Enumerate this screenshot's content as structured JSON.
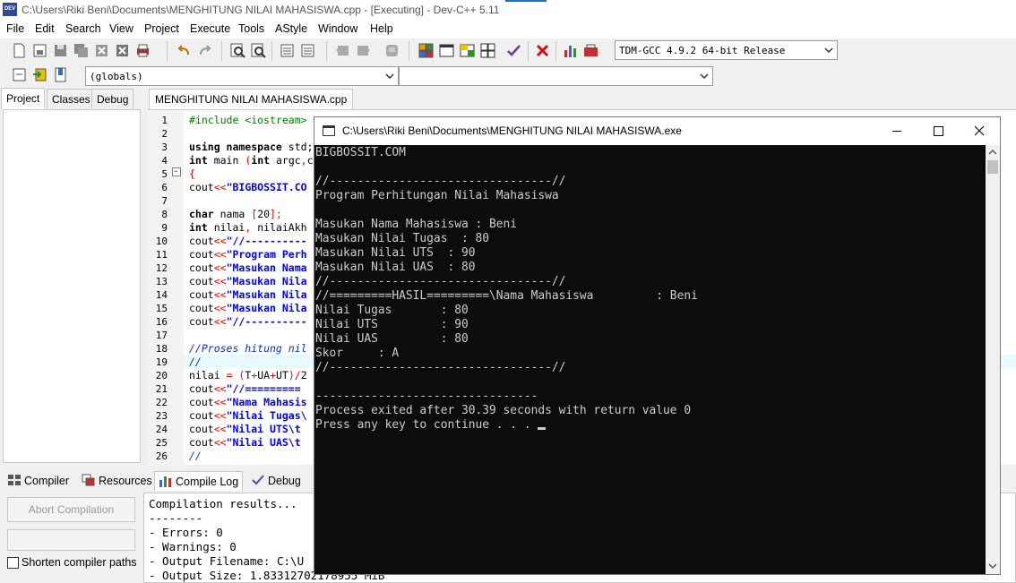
{
  "window": {
    "title": "C:\\Users\\Riki Beni\\Documents\\MENGHITUNG NILAI MAHASISWA.cpp - [Executing] - Dev-C++ 5.11",
    "app_icon_label": "DEV"
  },
  "menu": [
    "File",
    "Edit",
    "Search",
    "View",
    "Project",
    "Execute",
    "Tools",
    "AStyle",
    "Window",
    "Help"
  ],
  "toolbar": {
    "compiler_select": "TDM-GCC 4.9.2 64-bit Release",
    "scope_select": "(globals)",
    "member_select": ""
  },
  "left_panel": {
    "tabs": [
      "Project",
      "Classes",
      "Debug"
    ],
    "active_tab": "Project"
  },
  "editor": {
    "file_tab": "MENGHITUNG NILAI MAHASISWA.cpp",
    "line_numbers": [
      "1",
      "2",
      "3",
      "4",
      "5",
      "6",
      "7",
      "8",
      "9",
      "10",
      "11",
      "12",
      "13",
      "14",
      "15",
      "16",
      "17",
      "18",
      "19",
      "20",
      "21",
      "22",
      "23",
      "24",
      "25",
      "26"
    ],
    "lines": [
      [
        {
          "t": "#include <iostream>",
          "c": "pp"
        }
      ],
      [],
      [
        {
          "t": "using namespace ",
          "c": "kw"
        },
        {
          "t": "std;",
          "c": ""
        }
      ],
      [
        {
          "t": "int ",
          "c": "kw"
        },
        {
          "t": "main ",
          "c": ""
        },
        {
          "t": "(",
          "c": "op"
        },
        {
          "t": "int ",
          "c": "kw"
        },
        {
          "t": "argc",
          "c": ""
        },
        {
          "t": ",",
          "c": "op"
        },
        {
          "t": "c",
          "c": ""
        }
      ],
      [
        {
          "t": "{",
          "c": "op"
        }
      ],
      [
        {
          "t": " cout",
          "c": ""
        },
        {
          "t": "<<",
          "c": "op"
        },
        {
          "t": "\"BIGBOSSIT.CO",
          "c": "str"
        }
      ],
      [],
      [
        {
          "t": "  char ",
          "c": "kw"
        },
        {
          "t": "nama ",
          "c": ""
        },
        {
          "t": "[",
          "c": "op"
        },
        {
          "t": "20",
          "c": ""
        },
        {
          "t": "];",
          "c": "op"
        }
      ],
      [
        {
          "t": "  int ",
          "c": "kw"
        },
        {
          "t": "nilai",
          "c": ""
        },
        {
          "t": ", ",
          "c": "op"
        },
        {
          "t": "nilaiAkh",
          "c": ""
        }
      ],
      [
        {
          "t": "  cout",
          "c": ""
        },
        {
          "t": "<<",
          "c": "op"
        },
        {
          "t": "\"//----------",
          "c": "str"
        }
      ],
      [
        {
          "t": "  cout",
          "c": ""
        },
        {
          "t": "<<",
          "c": "op"
        },
        {
          "t": "\"Program Perh",
          "c": "str"
        }
      ],
      [
        {
          "t": "  cout",
          "c": ""
        },
        {
          "t": "<<",
          "c": "op"
        },
        {
          "t": "\"Masukan Nama",
          "c": "str"
        }
      ],
      [
        {
          "t": "  cout",
          "c": ""
        },
        {
          "t": "<<",
          "c": "op"
        },
        {
          "t": "\"Masukan Nila",
          "c": "str"
        }
      ],
      [
        {
          "t": "  cout",
          "c": ""
        },
        {
          "t": "<<",
          "c": "op"
        },
        {
          "t": "\"Masukan Nila",
          "c": "str"
        }
      ],
      [
        {
          "t": "  cout",
          "c": ""
        },
        {
          "t": "<<",
          "c": "op"
        },
        {
          "t": "\"Masukan Nila",
          "c": "str"
        }
      ],
      [
        {
          "t": "  cout",
          "c": ""
        },
        {
          "t": "<<",
          "c": "op"
        },
        {
          "t": "\"//----------",
          "c": "str"
        }
      ],
      [],
      [
        {
          "t": "  //Proses hitung nil",
          "c": "cm"
        }
      ],
      [
        {
          "t": "  //",
          "c": "cm"
        }
      ],
      [
        {
          "t": "  nilai ",
          "c": ""
        },
        {
          "t": "= (",
          "c": "op"
        },
        {
          "t": "T",
          "c": ""
        },
        {
          "t": "+",
          "c": "op"
        },
        {
          "t": "UA",
          "c": ""
        },
        {
          "t": "+",
          "c": "op"
        },
        {
          "t": "UT",
          "c": ""
        },
        {
          "t": ")/",
          "c": "op"
        },
        {
          "t": "2",
          "c": ""
        }
      ],
      [
        {
          "t": "  cout",
          "c": ""
        },
        {
          "t": "<<",
          "c": "op"
        },
        {
          "t": "\"//=========",
          "c": "str"
        }
      ],
      [
        {
          "t": "  cout",
          "c": ""
        },
        {
          "t": "<<",
          "c": "op"
        },
        {
          "t": "\"Nama Mahasis",
          "c": "str"
        }
      ],
      [
        {
          "t": "  cout",
          "c": ""
        },
        {
          "t": "<<",
          "c": "op"
        },
        {
          "t": "\"Nilai Tugas\\",
          "c": "str"
        }
      ],
      [
        {
          "t": "  cout",
          "c": ""
        },
        {
          "t": "<<",
          "c": "op"
        },
        {
          "t": "\"Nilai UTS\\t ",
          "c": "str"
        }
      ],
      [
        {
          "t": "  cout",
          "c": ""
        },
        {
          "t": "<<",
          "c": "op"
        },
        {
          "t": "\"Nilai UAS\\t ",
          "c": "str"
        }
      ],
      [
        {
          "t": "  //",
          "c": "cm"
        }
      ]
    ]
  },
  "bottom": {
    "tabs": [
      "Compiler",
      "Resources",
      "Compile Log",
      "Debug"
    ],
    "active_tab": "Compile Log",
    "abort_button": "Abort Compilation",
    "shorten_label": "Shorten compiler paths",
    "log": [
      "Compilation results...",
      "--------",
      "- Errors: 0",
      "- Warnings: 0",
      "- Output Filename: C:\\U",
      "- Output Size: 1.83312702178955 MiB"
    ]
  },
  "console": {
    "title": "C:\\Users\\Riki Beni\\Documents\\MENGHITUNG NILAI MAHASISWA.exe",
    "lines": [
      "BIGBOSSIT.COM",
      "",
      "//--------------------------------//",
      "Program Perhitungan Nilai Mahasiswa",
      "",
      "Masukan Nama Mahasiswa : Beni",
      "Masukan Nilai Tugas  : 80",
      "Masukan Nilai UTS  : 90",
      "Masukan Nilai UAS  : 80",
      "//--------------------------------//",
      "//=========HASIL=========\\Nama Mahasiswa         : Beni",
      "Nilai Tugas       : 80",
      "Nilai UTS         : 90",
      "Nilai UAS         : 80",
      "Skor     : A",
      "//--------------------------------//",
      "",
      "--------------------------------",
      "Process exited after 30.39 seconds with return value 0",
      "Press any key to continue . . . "
    ]
  }
}
